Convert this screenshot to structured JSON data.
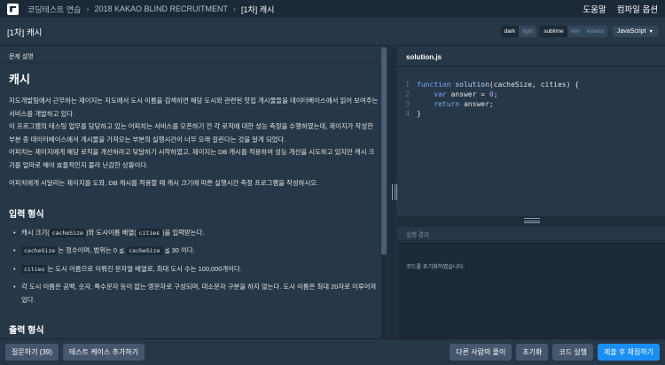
{
  "topbar": {
    "breadcrumbs": [
      "코딩테스트 연습",
      "2018 KAKAO BLIND RECRUITMENT",
      "[1차] 캐시"
    ],
    "nav": [
      "도움말",
      "컴파일 옵션"
    ]
  },
  "header": {
    "title": "[1차] 캐시",
    "theme_options": [
      "dark",
      "light"
    ],
    "editor_options": [
      "sublime",
      "vim",
      "emacs"
    ],
    "language": "JavaScript"
  },
  "problem": {
    "section_label": "문제 설명",
    "heading": "캐시",
    "paragraphs": [
      "지도개발팀에서 근무하는 제이지는 지도에서 도시 이름을 검색하면 해당 도시와 관련된 맛집 게시물들을 데이터베이스에서 읽어 보여주는 서비스를 개발하고 있다.",
      "이 프로그램의 테스팅 업무를 담당하고 있는 어피치는 서비스를 오픈하기 전 각 로직에 대한 성능 측정을 수행하였는데, 제이지가 작성한 부분 중 데이터베이스에서 게시물을 가져오는 부분의 실행시간이 너무 오래 걸린다는 것을 알게 되었다.",
      "어피치는 제이지에게 해당 로직을 개선하라고 닦달하기 시작하였고, 제이지는 DB 캐시를 적용하여 성능 개선을 시도하고 있지만 캐시 크기를 얼마로 해야 효율적인지 몰라 난감한 상황이다.",
      "어피치에게 시달리는 제이지를 도와, DB 캐시를 적용할 때 캐시 크기에 따른 실행시간 측정 프로그램을 작성하시오."
    ],
    "input_heading": "입력 형식",
    "input_items": [
      {
        "pre": "캐시 크기(",
        "code1": "cacheSize",
        "mid": ")와 도시이름 배열(",
        "code2": "cities",
        "post": ")을 입력받는다."
      },
      {
        "pre": "",
        "code1": "cacheSize",
        "mid": "는 정수이며, 범위는 0 ≦ ",
        "code2": "cacheSize",
        "post": " ≦ 30 이다."
      },
      {
        "pre": "",
        "code1": "cities",
        "mid": "는 도시 이름으로 이뤄진 문자열 배열로, 최대 도시 수는 100,000개이다.",
        "code2": "",
        "post": ""
      },
      {
        "pre": "각 도시 이름은 공백, 숫자, 특수문자 등이 없는 영문자로 구성되며, 대소문자 구분을 하지 않는다. 도시 이름은 최대 20자로 이루어져 있다.",
        "code1": "",
        "mid": "",
        "code2": "",
        "post": ""
      }
    ],
    "output_heading": "출력 형식"
  },
  "editor": {
    "filename": "solution.js",
    "line_numbers": [
      "1",
      "2",
      "3",
      "4"
    ],
    "code": {
      "l1_kw": "function",
      "l1_fn": "solution",
      "l1_rest": "(cacheSize, cities) {",
      "l2_kw": "var",
      "l2_mid": " answer = ",
      "l2_num": "0",
      "l2_end": ";",
      "l3_kw": "return",
      "l3_rest": " answer;",
      "l4": "}"
    }
  },
  "result": {
    "label": "실행 결과",
    "message": "코드를 초기화하였습니다."
  },
  "bottom": {
    "question_button": "질문하기 (39)",
    "add_testcase_button": "테스트 케이스 추가하기",
    "others_solution_button": "다른 사람의 풀이",
    "reset_button": "초기화",
    "run_button": "코드 실행",
    "submit_button": "제출 후 채점하기"
  },
  "colors": {
    "background": "#263747",
    "topbar": "#1b2938",
    "primary": "#1a8ef2",
    "button": "#44576c"
  }
}
